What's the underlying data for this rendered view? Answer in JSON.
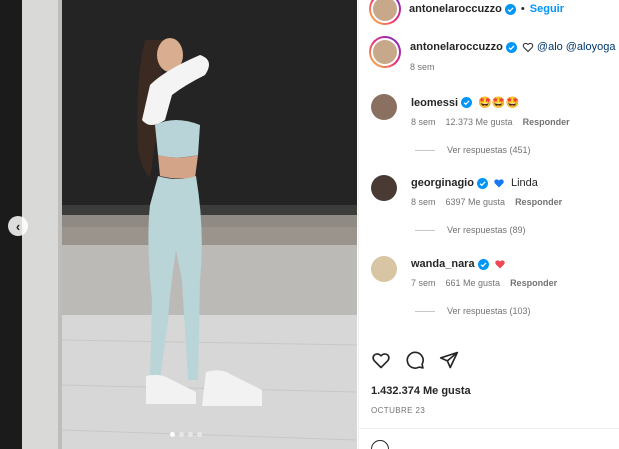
{
  "post": {
    "author": "antonelaroccuzzo",
    "follow_label": "Seguir",
    "separator": "•",
    "caption_mentions": [
      "@alo",
      "@aloyoga"
    ],
    "caption_time": "8 sem",
    "likes": "1.432.374 Me gusta",
    "date": "OCTUBRE 23",
    "carousel": {
      "slides": 4,
      "active_index": 0
    }
  },
  "comments": [
    {
      "user": "leomessi",
      "text": "🤩🤩🤩",
      "time": "8 sem",
      "likes": "12.373 Me gusta",
      "reply_label": "Responder",
      "view_replies": "Ver respuestas (451)"
    },
    {
      "user": "georginagio",
      "text": "Linda",
      "time": "8 sem",
      "likes": "6397 Me gusta",
      "reply_label": "Responder",
      "view_replies": "Ver respuestas (89)"
    },
    {
      "user": "wanda_nara",
      "text": "",
      "time": "7 sem",
      "likes": "661 Me gusta",
      "reply_label": "Responder",
      "view_replies": "Ver respuestas (103)"
    }
  ],
  "icons": {
    "verified": "verified-badge-icon",
    "heart": "heart-icon",
    "comment": "comment-icon",
    "share": "share-icon",
    "blue_heart": "blue-heart-icon",
    "red_heart": "red-heart-icon",
    "prev": "chevron-left-icon"
  },
  "colors": {
    "accent": "#0095f6",
    "verified": "#0095f6",
    "blue_heart": "#1877f2",
    "red_heart": "#ed4956"
  }
}
